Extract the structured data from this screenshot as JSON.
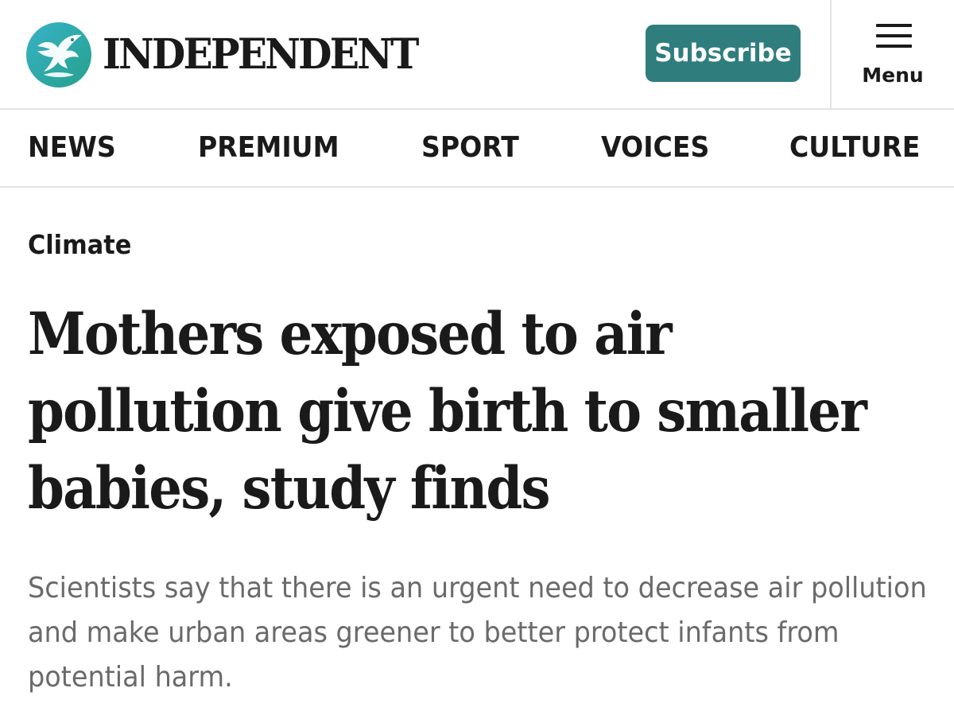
{
  "header": {
    "brand_name": "INDEPENDENT",
    "subscribe_label": "Subscribe",
    "menu_label": "Menu"
  },
  "nav": {
    "items": [
      {
        "label": "NEWS"
      },
      {
        "label": "PREMIUM"
      },
      {
        "label": "SPORT"
      },
      {
        "label": "VOICES"
      },
      {
        "label": "CULTURE"
      }
    ]
  },
  "article": {
    "section": "Climate",
    "headline": "Mothers exposed to air pollution give birth to smaller babies, study finds",
    "standfirst": "Scientists say that there is an urgent need to decrease air pollution and make urban areas greener to better protect infants from potential harm."
  },
  "icons": {
    "logo": "eagle-logo-icon",
    "menu": "hamburger-icon"
  },
  "colors": {
    "brand_teal": "#2f7d7d",
    "logo_gradient_start": "#37b2c6",
    "logo_gradient_end": "#27a08c",
    "text_primary": "#1a1a1a",
    "text_secondary": "#6a6a6a",
    "divider": "#e3e3e3"
  }
}
